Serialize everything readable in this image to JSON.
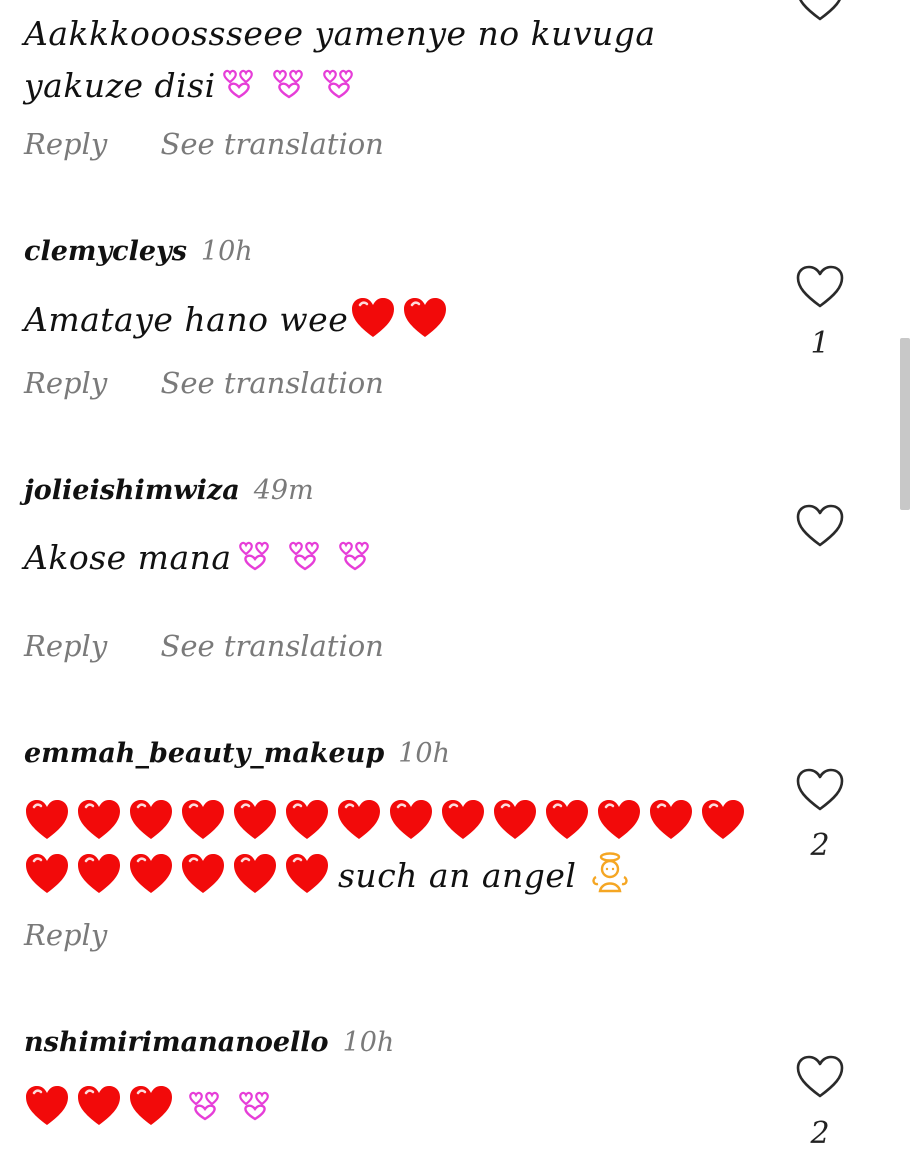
{
  "comments": [
    {
      "username": "",
      "time": "",
      "text": "Aakkkooossseee yamenye no kuvuga yakuze disi",
      "text_line1": "Aakkkooossseee yamenye no kuvuga",
      "text_line2": "yakuze disi",
      "trailing_emoji": [
        "revolving-hearts",
        "revolving-hearts",
        "revolving-hearts"
      ],
      "actions": [
        "Reply",
        "See translation"
      ],
      "likes": ""
    },
    {
      "username": "clemycleys",
      "time": "10h",
      "text": "Amataye hano wee",
      "trailing_emoji": [
        "red-heart",
        "red-heart"
      ],
      "actions": [
        "Reply",
        "See translation"
      ],
      "likes": "1"
    },
    {
      "username": "jolieishimwiza",
      "time": "49m",
      "text": "Akose mana",
      "trailing_emoji": [
        "revolving-hearts",
        "revolving-hearts",
        "revolving-hearts"
      ],
      "actions": [
        "Reply",
        "See translation"
      ],
      "likes": ""
    },
    {
      "username": "emmah_beauty_makeup",
      "time": "10h",
      "leading_emoji_line1": 14,
      "leading_emoji_line2": 6,
      "text": "such an angel",
      "trailing_emoji": [
        "baby-angel"
      ],
      "actions": [
        "Reply"
      ],
      "likes": "2"
    },
    {
      "username": "nshimirimananoello",
      "time": "10h",
      "text": "",
      "leading_emoji": [
        "red-heart",
        "red-heart",
        "red-heart",
        "revolving-hearts",
        "revolving-hearts"
      ],
      "actions": [],
      "likes": "2"
    }
  ],
  "colors": {
    "heart_red": "#f20a0a",
    "heart_pink": "#e63ed8",
    "muted_text": "#7a7a7a",
    "like_outline": "#2a2a2a",
    "scrollbar": "#c8c8c8",
    "angel": "#f5a623"
  },
  "icons": {
    "like": "heart-outline-icon",
    "red_heart": "red-heart-emoji",
    "pink_hearts": "revolving-hearts-emoji",
    "angel": "baby-angel-emoji"
  }
}
